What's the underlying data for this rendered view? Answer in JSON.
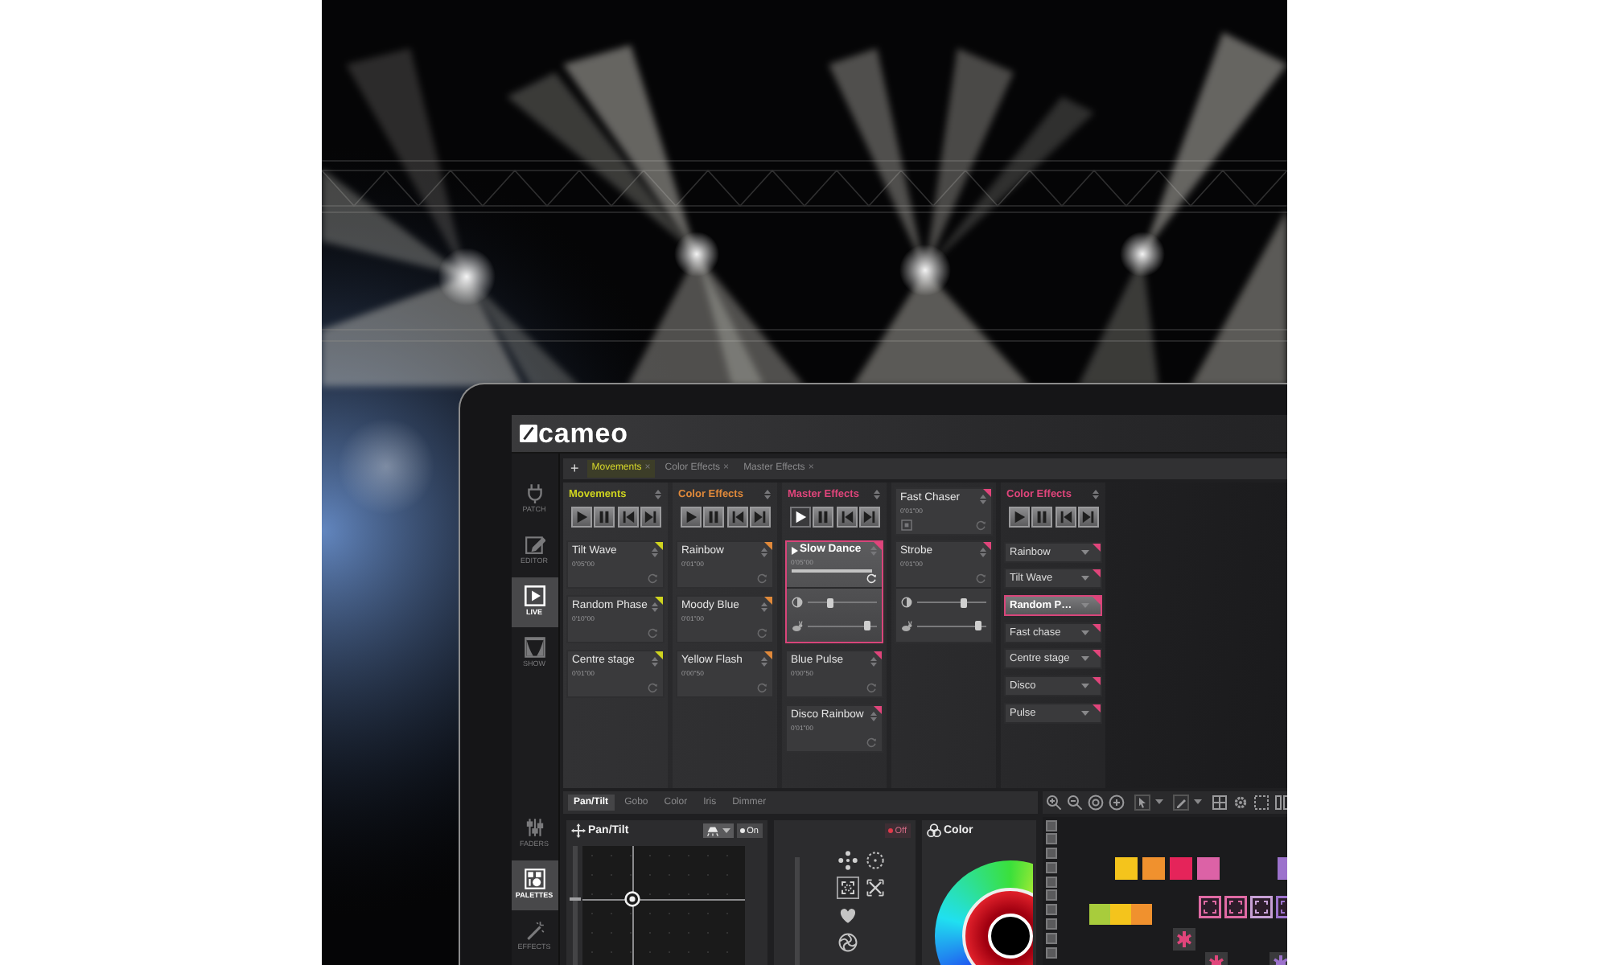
{
  "app": {
    "logo": "cameo",
    "sidebar": {
      "top": [
        {
          "kind": "patch",
          "label": "PATCH",
          "selected": false
        },
        {
          "kind": "editor",
          "label": "EDITOR",
          "selected": false
        },
        {
          "kind": "live",
          "label": "LIVE",
          "selected": true
        },
        {
          "kind": "show",
          "label": "SHOW",
          "selected": false
        }
      ],
      "bottom": [
        {
          "kind": "faders",
          "label": "FADERS",
          "selected": false
        },
        {
          "kind": "palettes",
          "label": "PALETTES",
          "selected": true
        },
        {
          "kind": "effects",
          "label": "EFFECTS",
          "selected": false
        }
      ]
    },
    "add_tab": "+",
    "tabs": [
      {
        "label": "Movements",
        "close": "×",
        "selected": true
      },
      {
        "label": "Color Effects",
        "close": "×",
        "selected": false
      },
      {
        "label": "Master Effects",
        "close": "×",
        "selected": false
      }
    ],
    "cue_columns": [
      {
        "kind": "cuelist",
        "title": "Movements",
        "color": "#cfd41f",
        "playing": false,
        "cues": [
          {
            "name": "Tilt Wave",
            "time": "0'05\"00",
            "playing": false
          },
          {
            "name": "Random Phase",
            "time": "0'10\"00",
            "playing": false
          },
          {
            "name": "Centre stage",
            "time": "0'01\"00",
            "playing": false
          }
        ]
      },
      {
        "kind": "cuelist",
        "title": "Color Effects",
        "color": "#e0893a",
        "playing": false,
        "cues": [
          {
            "name": "Rainbow",
            "time": "0'01\"00",
            "playing": false
          },
          {
            "name": "Moody Blue",
            "time": "0'01\"00",
            "playing": false
          },
          {
            "name": "Yellow Flash",
            "time": "0'00\"50",
            "playing": false
          }
        ]
      },
      {
        "kind": "cuelist",
        "title": "Master Effects",
        "color": "#e0457b",
        "playing": true,
        "cues": [
          {
            "name": "Slow Dance",
            "time": "0'05\"00",
            "playing": true,
            "progress": {
              "level": 0.95
            },
            "sliders": [
              {
                "kind": "dimmer",
                "level": 0.33
              },
              {
                "kind": "speed",
                "level": 0.88
              }
            ]
          },
          {
            "name": "Blue Pulse",
            "time": "0'00\"50",
            "playing": false
          },
          {
            "name": "Disco Rainbow",
            "time": "0'01\"00",
            "playing": false
          }
        ]
      },
      {
        "kind": "chaser",
        "title": "Fast Chaser",
        "time": "0'01\"00",
        "color": "#e0457b",
        "cues": [
          {
            "name": "Strobe",
            "time": "0'01\"00",
            "playing": false,
            "sliders": [
              {
                "kind": "dimmer",
                "level": 0.68
              },
              {
                "kind": "speed",
                "level": 0.9
              }
            ]
          }
        ]
      },
      {
        "kind": "list",
        "title": "Color Effects",
        "color": "#e0457b",
        "playing": false,
        "items": [
          {
            "label": "Rainbow",
            "selected": false
          },
          {
            "label": "Tilt Wave",
            "selected": false
          },
          {
            "label": "Random P…",
            "selected": true
          },
          {
            "label": "Fast chase",
            "selected": false
          },
          {
            "label": "Centre stage",
            "selected": false
          },
          {
            "label": "Disco",
            "selected": false
          },
          {
            "label": "Pulse",
            "selected": false
          }
        ]
      }
    ],
    "palette_tabs": [
      {
        "label": "Pan/Tilt",
        "selected": true
      },
      {
        "label": "Gobo",
        "selected": false
      },
      {
        "label": "Color",
        "selected": false
      },
      {
        "label": "Iris",
        "selected": false
      },
      {
        "label": "Dimmer",
        "selected": false
      }
    ],
    "pan_tilt": {
      "title": "Pan/Tilt",
      "toggle": {
        "label": "On",
        "on": true
      },
      "pan": {
        "level": 0.31
      },
      "tilt": {
        "level": 0.55
      }
    },
    "gobo": {
      "toggle": {
        "label": "Off",
        "on": false
      },
      "gobos": [
        {
          "kind": "dots",
          "selected": false
        },
        {
          "kind": "ring",
          "selected": false
        },
        {
          "kind": "corners",
          "selected": true
        },
        {
          "kind": "arrows",
          "selected": false
        },
        {
          "kind": "heart",
          "selected": false
        },
        {
          "kind": "swirl",
          "selected": false
        }
      ]
    },
    "color_panel": {
      "title": "Color"
    },
    "palette_canvas": {
      "swatches": [
        {
          "color": "#f4c41c"
        },
        {
          "color": "#f0912e"
        },
        {
          "color": "#e5245a"
        },
        {
          "color": "#dc62a6"
        },
        {
          "color": "#9c72cc"
        },
        {
          "color": "#a8cc3c"
        },
        {
          "color": "#f4c41c"
        },
        {
          "color": "#f0912e"
        }
      ],
      "gobo_frames": [
        {
          "color": "#e06aa4"
        },
        {
          "color": "#e06aa4"
        },
        {
          "color": "#c7a0d6"
        },
        {
          "color": "#9c72cc"
        }
      ],
      "star_tiles": [
        {
          "color": "#e0457b"
        },
        {
          "color": "#e0457b"
        },
        {
          "color": "#9c72cc"
        }
      ]
    }
  }
}
